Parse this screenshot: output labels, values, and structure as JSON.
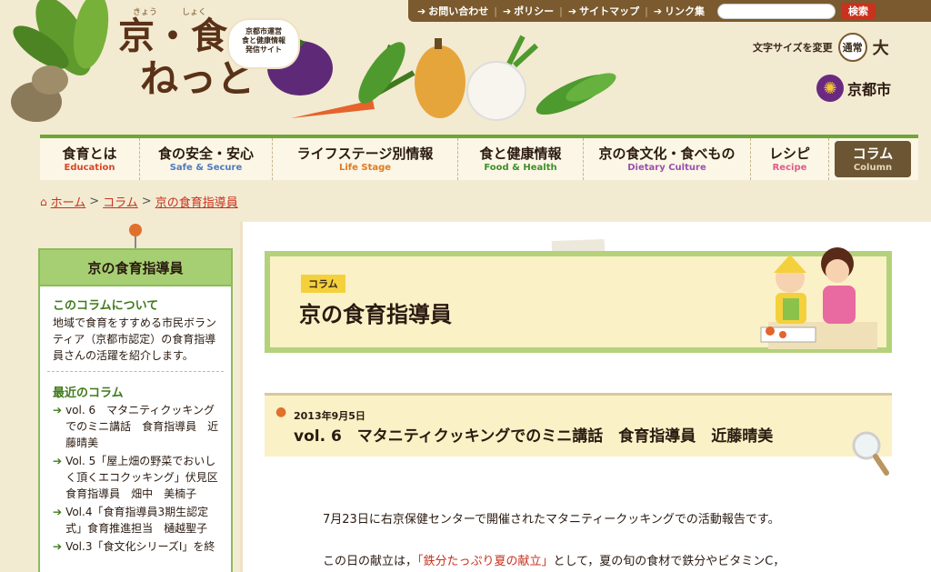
{
  "site": {
    "logo_ruby_1": "きょう",
    "logo_ruby_2": "しょく",
    "logo_main": "京・食",
    "logo_sub": "ねっと",
    "logo_badge_line1": "京都市運営",
    "logo_badge_line2": "食と健康情報",
    "logo_badge_line3": "発信サイト",
    "city_name": "京都市"
  },
  "utility": {
    "links": [
      "お問い合わせ",
      "ポリシー",
      "サイトマップ",
      "リンク集"
    ],
    "search_placeholder": "",
    "search_button": "検索"
  },
  "fontsize": {
    "label": "文字サイズを変更",
    "normal": "通常",
    "large": "大"
  },
  "nav": {
    "items": [
      {
        "jp": "食育とは",
        "en": "Education",
        "color": "#d9462b"
      },
      {
        "jp": "食の安全・安心",
        "en": "Safe & Secure",
        "color": "#4f7ac0"
      },
      {
        "jp": "ライフステージ別情報",
        "en": "Life Stage",
        "color": "#e07a1f"
      },
      {
        "jp": "食と健康情報",
        "en": "Food & Health",
        "color": "#3f8f2a"
      },
      {
        "jp": "京の食文化・食べもの",
        "en": "Dietary Culture",
        "color": "#9a50b0"
      },
      {
        "jp": "レシピ",
        "en": "Recipe",
        "color": "#e05a8a"
      },
      {
        "jp": "コラム",
        "en": "Column",
        "color": "#ffffff"
      }
    ]
  },
  "breadcrumb": {
    "home": "ホーム",
    "column": "コラム",
    "current": "京の食育指導員"
  },
  "sidebar": {
    "title": "京の食育指導員",
    "about_title": "このコラムについて",
    "about_text": "地域で食育をすすめる市民ボランティア（京都市認定）の食育指導員さんの活躍を紹介します。",
    "recent_title": "最近のコラム",
    "recent": [
      "vol. 6　マタニティクッキングでのミニ講話　食育指導員　近藤晴美",
      "Vol. 5「屋上畑の野菜でおいしく頂くエコクッキング」伏見区食育指導員　畑中　美楠子",
      "Vol.4「食育指導員3期生認定式」食育推進担当　樋越聖子",
      "Vol.3「食文化シリーズⅠ」を終"
    ]
  },
  "main": {
    "category": "コラム",
    "title": "京の食育指導員",
    "date": "2013年9月5日",
    "article_title": "vol. 6　マタニティクッキングでのミニ講話　食育指導員　近藤晴美",
    "para1": "7月23日に右京保健センターで開催されたマタニティークッキングでの活動報告です。",
    "para2_prefix": "この日の献立は，",
    "para2_highlight": "「鉄分たっぷり夏の献立」",
    "para2_suffix": "として，夏の旬の食材で鉄分やビタミンC，"
  }
}
